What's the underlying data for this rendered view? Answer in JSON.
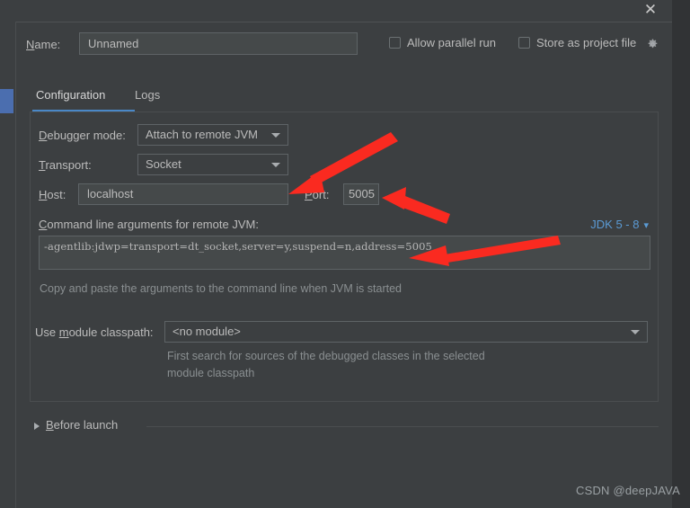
{
  "window": {
    "close_icon": "close-icon"
  },
  "name_row": {
    "label": "Name:",
    "value": "Unnamed",
    "allow_parallel_run": "Allow parallel run",
    "store_as_project_file": "Store as project file",
    "gear_icon": "gear-icon",
    "allow_parallel_checked": false,
    "store_as_project_checked": false
  },
  "tabs": [
    {
      "label": "Configuration",
      "active": true
    },
    {
      "label": "Logs",
      "active": false
    }
  ],
  "configuration": {
    "debugger_mode_label": "Debugger mode:",
    "debugger_mode_value": "Attach to remote JVM",
    "transport_label": "Transport:",
    "transport_value": "Socket",
    "host_label": "Host:",
    "host_value": "localhost",
    "port_label": "Port:",
    "port_value": "5005",
    "args_label": "Command line arguments for remote JVM:",
    "jdk_selector": "JDK 5 - 8",
    "jdk_chevron_icon": "chevron-down-icon",
    "args_value": "-agentlib:jdwp=transport=dt_socket,server=y,suspend=n,address=5005",
    "args_hint": "Copy and paste the arguments to the command line when JVM is started",
    "module_classpath_label": "Use module classpath:",
    "module_classpath_value": "<no module>",
    "module_hint_line1": "First search for sources of the debugged classes in the selected",
    "module_hint_line2": "module classpath"
  },
  "before_launch": {
    "label": "Before launch",
    "expander_icon": "chevron-right-icon"
  },
  "watermark": "CSDN @deepJAVA",
  "colors": {
    "background": "#3c3f41",
    "field_background": "#45494a",
    "border": "#5e6366",
    "accent_blue": "#4a88c7",
    "link_blue": "#5b9bd5",
    "annotation_red": "#fa2a20",
    "text": "#bbbbbb",
    "hint_text": "#8a8f91"
  },
  "annotations": [
    {
      "name": "arrow-to-host-field",
      "color": "#fa2a20"
    },
    {
      "name": "arrow-to-port-field",
      "color": "#fa2a20"
    },
    {
      "name": "arrow-to-args-field",
      "color": "#fa2a20"
    }
  ]
}
